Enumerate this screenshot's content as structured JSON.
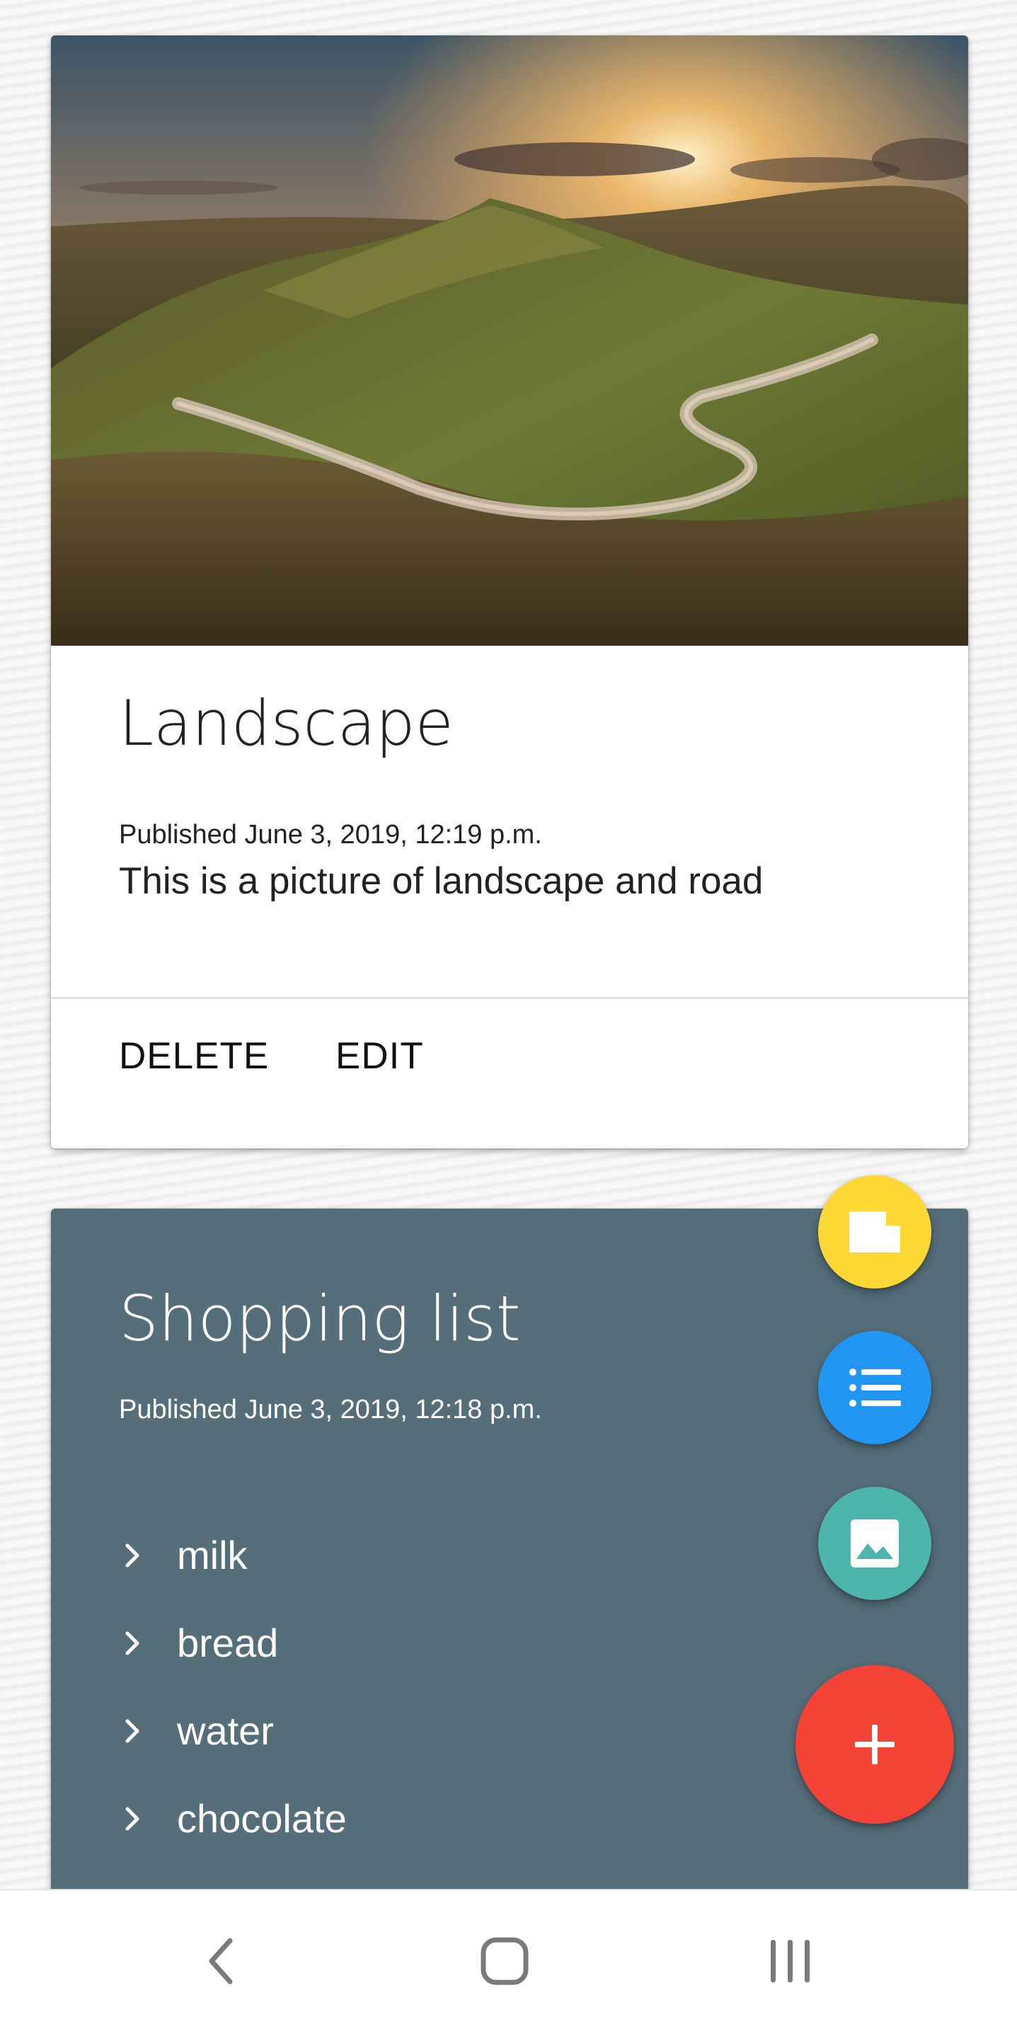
{
  "cards": {
    "landscape": {
      "title": "Landscape",
      "published": "Published June 3, 2019, 12:19 p.m.",
      "description": "This is a picture of landscape and road",
      "actions": {
        "delete_label": "DELETE",
        "edit_label": "EDIT"
      }
    },
    "shopping": {
      "title": "Shopping list",
      "published": "Published June 3, 2019, 12:18 p.m.",
      "items": [
        "milk",
        "bread",
        "water",
        "chocolate"
      ],
      "background_color": "#566e7a"
    }
  },
  "fabs": [
    {
      "icon": "note-icon",
      "color": "#fdd835"
    },
    {
      "icon": "list-icon",
      "color": "#2196f3"
    },
    {
      "icon": "image-icon",
      "color": "#4db6ac"
    },
    {
      "icon": "plus-icon",
      "color": "#f44336"
    }
  ],
  "navbar": {
    "buttons": [
      "back-icon",
      "home-icon",
      "recents-icon"
    ]
  }
}
